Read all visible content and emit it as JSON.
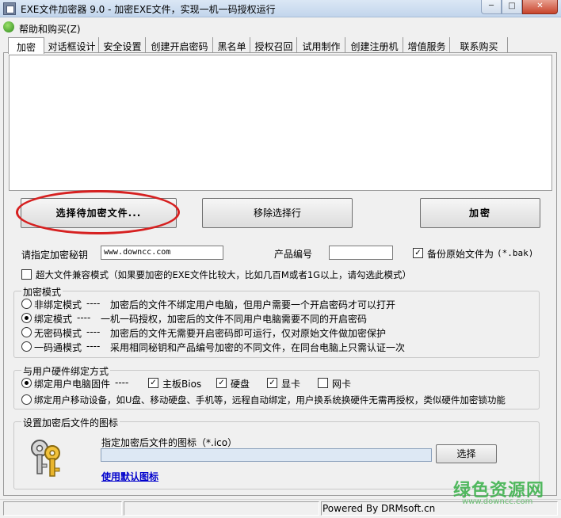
{
  "window": {
    "title": "EXE文件加密器 9.0 - 加密EXE文件，实现一机一码授权运行",
    "min_label": "─",
    "max_label": "□",
    "close_label": "✕"
  },
  "menu": {
    "help": "帮助和购买(Z)"
  },
  "tabs": [
    {
      "label": "加密"
    },
    {
      "label": "对话框设计"
    },
    {
      "label": "安全设置"
    },
    {
      "label": "创建开启密码"
    },
    {
      "label": "黑名单"
    },
    {
      "label": "授权召回"
    },
    {
      "label": "试用制作"
    },
    {
      "label": "创建注册机"
    },
    {
      "label": "增值服务"
    },
    {
      "label": "联系购买"
    }
  ],
  "buttons": {
    "select_file": "选择待加密文件...",
    "remove_row": "移除选择行",
    "encrypt": "加密",
    "choose_icon": "选择"
  },
  "key": {
    "label": "请指定加密秘钥",
    "value": "www.downcc.com"
  },
  "product": {
    "label": "产品编号",
    "value": ""
  },
  "backup": {
    "label": "备份原始文件为",
    "ext": "(*.bak)",
    "checked": true
  },
  "large_file": {
    "label": "超大文件兼容模式（如果要加密的EXE文件比较大，比如几百M或者1G以上，请勾选此模式）",
    "checked": false
  },
  "mode_group": {
    "title": "加密模式",
    "options": [
      {
        "name": "非绑定模式",
        "desc": "加密后的文件不绑定用户电脑，但用户需要一个开启密码才可以打开",
        "selected": false
      },
      {
        "name": "绑定模式",
        "desc": "一机一码授权，加密后的文件不同用户电脑需要不同的开启密码",
        "selected": true
      },
      {
        "name": "无密码模式",
        "desc": "加密后的文件无需要开启密码即可运行，仅对原始文件做加密保护",
        "selected": false
      },
      {
        "name": "一码通模式",
        "desc": "采用相同秘钥和产品编号加密的不同文件，在同台电脑上只需认证一次",
        "selected": false
      }
    ],
    "separator": "----"
  },
  "hardware_group": {
    "title": "与用户硬件绑定方式",
    "bind_pc": "绑定用户电脑固件",
    "separator": "----",
    "items": [
      {
        "label": "主板Bios",
        "checked": true
      },
      {
        "label": "硬盘",
        "checked": true
      },
      {
        "label": "显卡",
        "checked": true
      },
      {
        "label": "网卡",
        "checked": false
      }
    ],
    "bind_mobile": "绑定用户移动设备，如U盘、移动硬盘、手机等，远程自动绑定，用户换系统换硬件无需再授权，类似硬件加密锁功能"
  },
  "icon_group": {
    "title": "设置加密后文件的图标",
    "field_label": "指定加密后文件的图标（*.ico）",
    "field_value": "",
    "default_link": "使用默认图标"
  },
  "status": {
    "powered_by": "Powered By DRMsoft.cn"
  },
  "watermark": {
    "text": "绿色资源网",
    "url": "www.downcc.com"
  },
  "colors": {
    "highlight_ellipse": "#d62020",
    "link": "#0000cc",
    "watermark": "#3fb34f"
  }
}
